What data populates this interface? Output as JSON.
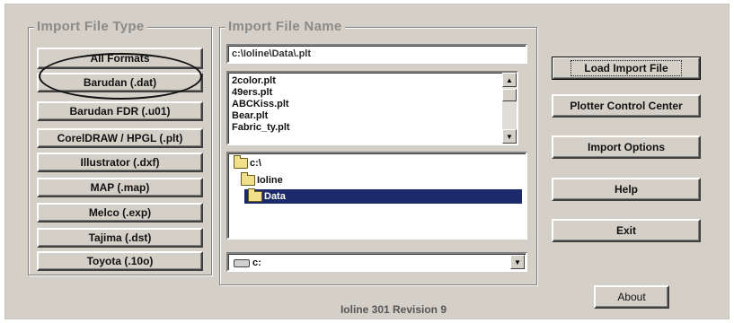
{
  "import_file_type": {
    "legend": "Import File Type",
    "buttons": [
      "All Formats",
      "Barudan (.dat)",
      "Barudan FDR (.u01)",
      "CorelDRAW / HPGL (.plt)",
      "Illustrator (.dxf)",
      "MAP (.map)",
      "Melco (.exp)",
      "Tajima (.dst)",
      "Toyota (.10o)"
    ]
  },
  "import_file_name": {
    "legend": "Import File Name",
    "path_value": "c:\\Ioline\\Data\\.plt",
    "files": [
      "2color.plt",
      "49ers.plt",
      "ABCKiss.plt",
      "Bear.plt",
      "Fabric_ty.plt"
    ],
    "directories": [
      {
        "label": "c:\\",
        "selected": false
      },
      {
        "label": "Ioline",
        "selected": false
      },
      {
        "label": "Data",
        "selected": true
      }
    ],
    "drive": "c:",
    "dropdown_arrow": "▼"
  },
  "actions": {
    "load_import_file": "Load Import File",
    "plotter_control_center": "Plotter Control Center",
    "import_options": "Import Options",
    "help": "Help",
    "exit": "Exit",
    "about": "About"
  },
  "status": "Ioline 301 Revision 9",
  "icons": {
    "scroll_up": "▲",
    "scroll_down": "▼"
  }
}
